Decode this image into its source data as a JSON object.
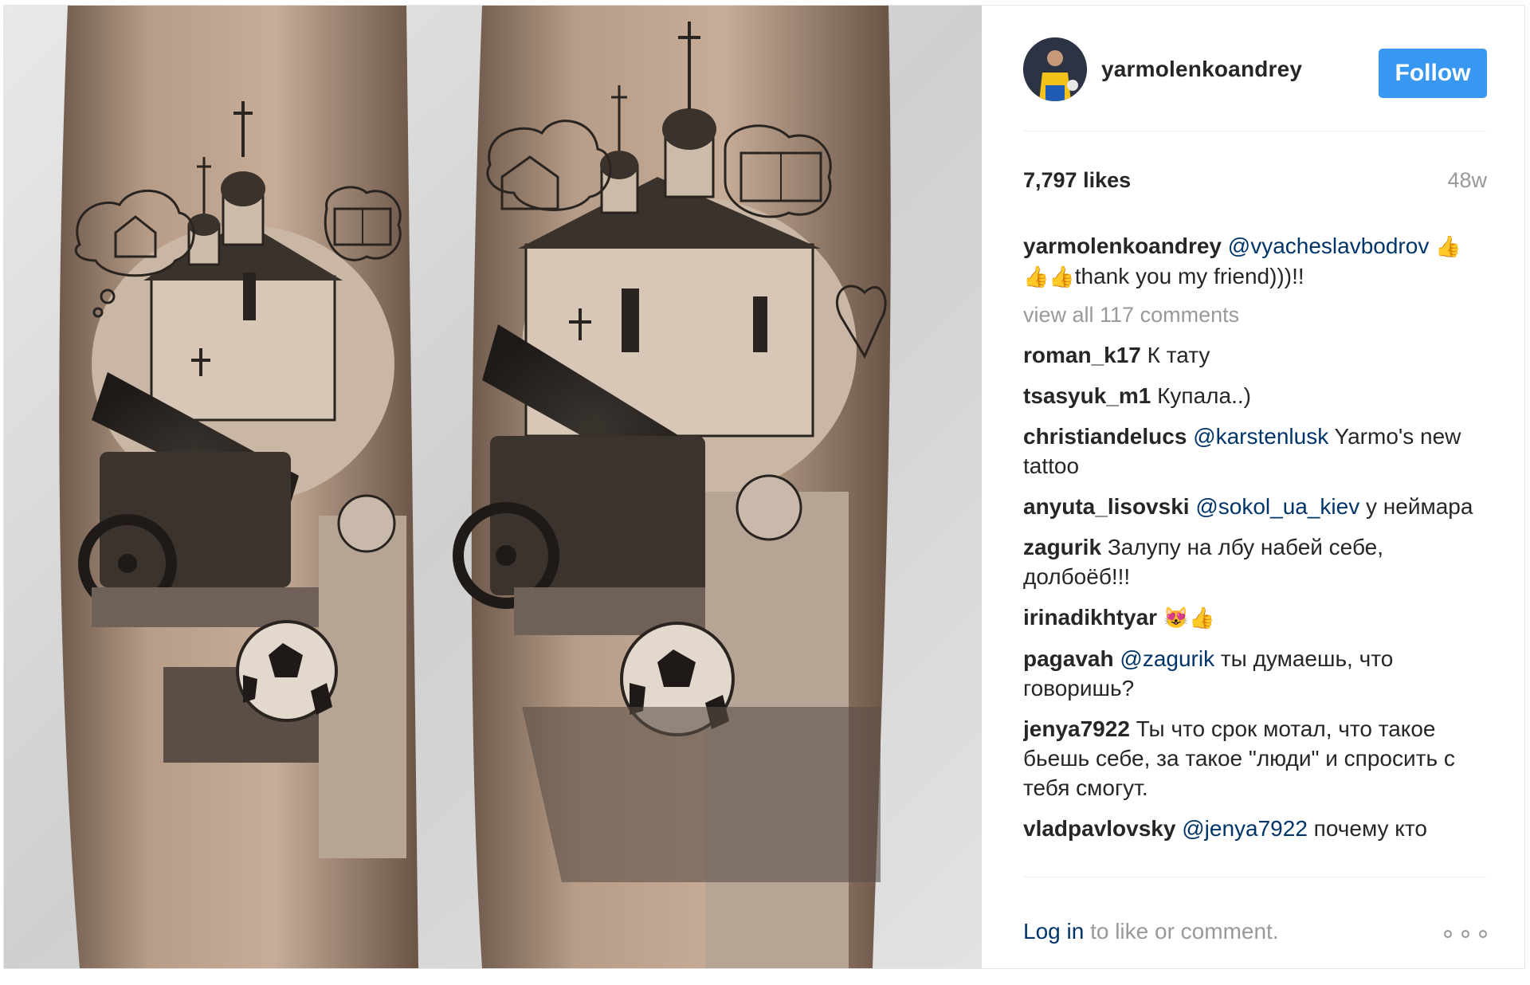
{
  "header": {
    "username": "yarmolenkoandrey",
    "follow_label": "Follow"
  },
  "stats": {
    "likes": "7,797 likes",
    "age": "48w"
  },
  "caption": {
    "user": "yarmolenkoandrey",
    "mention": "@vyacheslavbodrov",
    "text": "thank you my friend)))!!"
  },
  "view_all": "view all 117 comments",
  "comments": [
    {
      "user": "roman_k17",
      "mention": "",
      "text": "К тату"
    },
    {
      "user": "tsasyuk_m1",
      "mention": "",
      "text": "Купала..)"
    },
    {
      "user": "christiandelucs",
      "mention": "@karstenlusk",
      "text": "Yarmo's new tattoo"
    },
    {
      "user": "anyuta_lisovski",
      "mention": "@sokol_ua_kiev",
      "text": "у неймара"
    },
    {
      "user": "zagurik",
      "mention": "",
      "text": "Залупу на лбу набей себе, долбоёб!!!"
    },
    {
      "user": "irinadikhtyar",
      "mention": "",
      "text": ""
    },
    {
      "user": "pagavah",
      "mention": "@zagurik",
      "text": "ты думаешь, что говоришь?"
    },
    {
      "user": "jenya7922",
      "mention": "",
      "text": "Ты что срок мотал, что такое бьешь себе, за такое \"люди\" и спросить с тебя смогут."
    },
    {
      "user": "vladpavlovsky",
      "mention": "@jenya7922",
      "text": "почему кто"
    }
  ],
  "footer": {
    "login": "Log in",
    "rest": "to like or comment."
  },
  "icons": {
    "more": "more-options-icon",
    "thumbs_up": "thumbs-up-emoji",
    "heart_eyes_cat": "heart-eyes-cat-emoji"
  },
  "colors": {
    "follow_button": "#3897f0",
    "link": "#003569",
    "muted": "#999999"
  }
}
